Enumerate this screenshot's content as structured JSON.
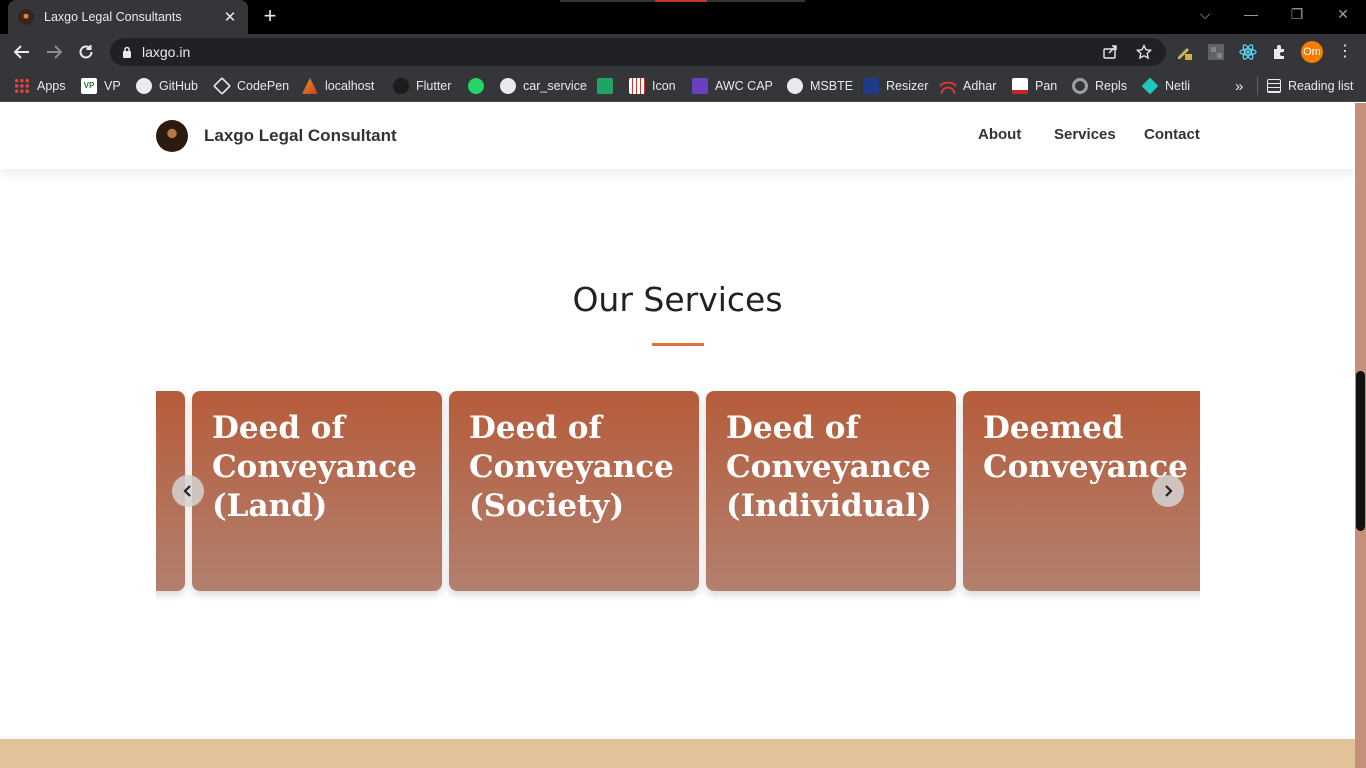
{
  "browser": {
    "tab_title": "Laxgo Legal Consultants",
    "url": "laxgo.in",
    "profile_initials": "Om",
    "bookmarks": [
      {
        "label": "Apps",
        "icon": "apps-grid-icon"
      },
      {
        "label": "VP",
        "icon": "vp-icon"
      },
      {
        "label": "GitHub",
        "icon": "github-icon"
      },
      {
        "label": "CodePen",
        "icon": "codepen-icon"
      },
      {
        "label": "localhost",
        "icon": "localhost-icon"
      },
      {
        "label": "Flutter",
        "icon": "github-icon"
      },
      {
        "label": "",
        "icon": "whatsapp-icon"
      },
      {
        "label": "car_service",
        "icon": "github-icon"
      },
      {
        "label": "",
        "icon": "green-app-icon"
      },
      {
        "label": "Icon",
        "icon": "icon-grid-icon"
      },
      {
        "label": "AWC CAP",
        "icon": "awc-icon"
      },
      {
        "label": "MSBTE",
        "icon": "msbte-icon"
      },
      {
        "label": "Resizer",
        "icon": "resizer-icon"
      },
      {
        "label": "Adhar",
        "icon": "adhar-icon"
      },
      {
        "label": "Pan",
        "icon": "nsdl-icon"
      },
      {
        "label": "Repls",
        "icon": "repls-icon"
      },
      {
        "label": "Netli",
        "icon": "netlify-icon"
      }
    ],
    "overflow_label": "»",
    "reading_list_label": "Reading list"
  },
  "site": {
    "brand": "Laxgo Legal Consultant",
    "nav": [
      "About",
      "Services",
      "Contact"
    ]
  },
  "services": {
    "title": "Our Services",
    "cards": [
      "Deed of Conveyance (Land)",
      "Deed of Conveyance (Society)",
      "Deed of Conveyance (Individual)",
      "Deemed Conveyance"
    ]
  },
  "colors": {
    "accent": "#e07040",
    "card_top": "#b65c3b",
    "card_bottom": "#b2806e",
    "footer_band": "#e2c299"
  }
}
